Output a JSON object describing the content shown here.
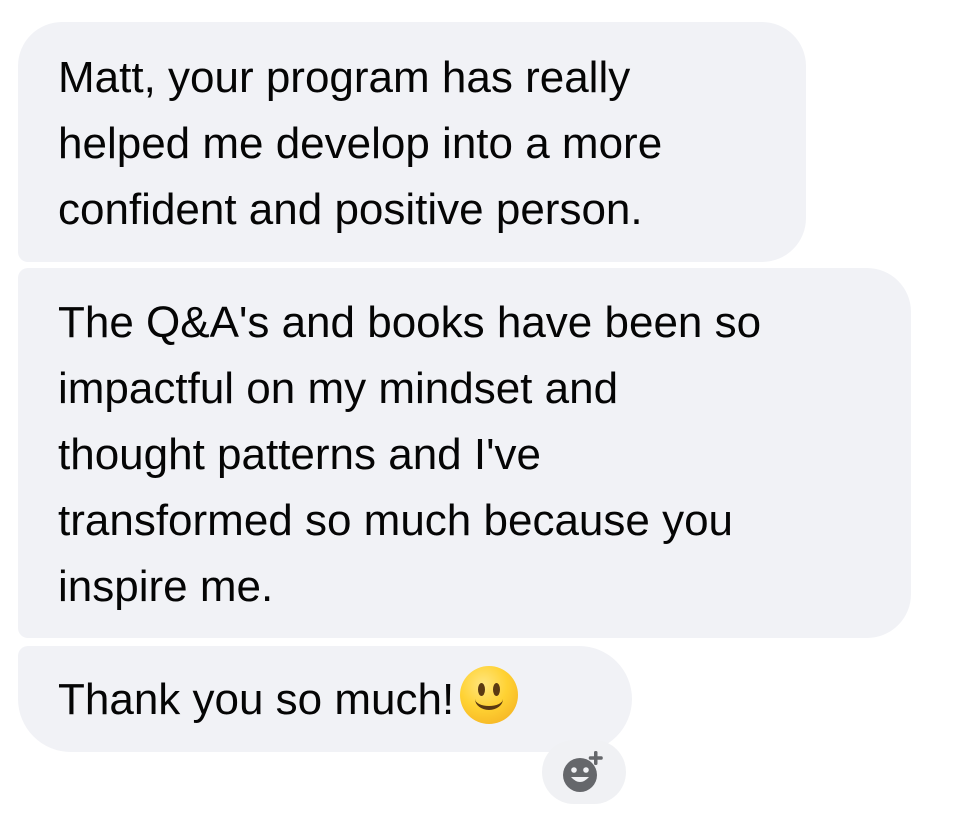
{
  "messages": [
    {
      "lines": [
        "Matt, your program has really",
        "helped me develop into a more",
        "confident and positive person."
      ]
    },
    {
      "lines": [
        "The Q&A's and books have been so",
        "impactful on my mindset and",
        "thought patterns and I've",
        "transformed so much because you",
        "inspire me."
      ]
    },
    {
      "text": "Thank you so much!",
      "emoji": "slightly-smiling-face-emoji"
    }
  ],
  "reaction_button": {
    "icon": "add-reaction-icon"
  },
  "colors": {
    "bubble_background": "#f1f2f6",
    "text": "#050505",
    "icon": "#65676b"
  }
}
